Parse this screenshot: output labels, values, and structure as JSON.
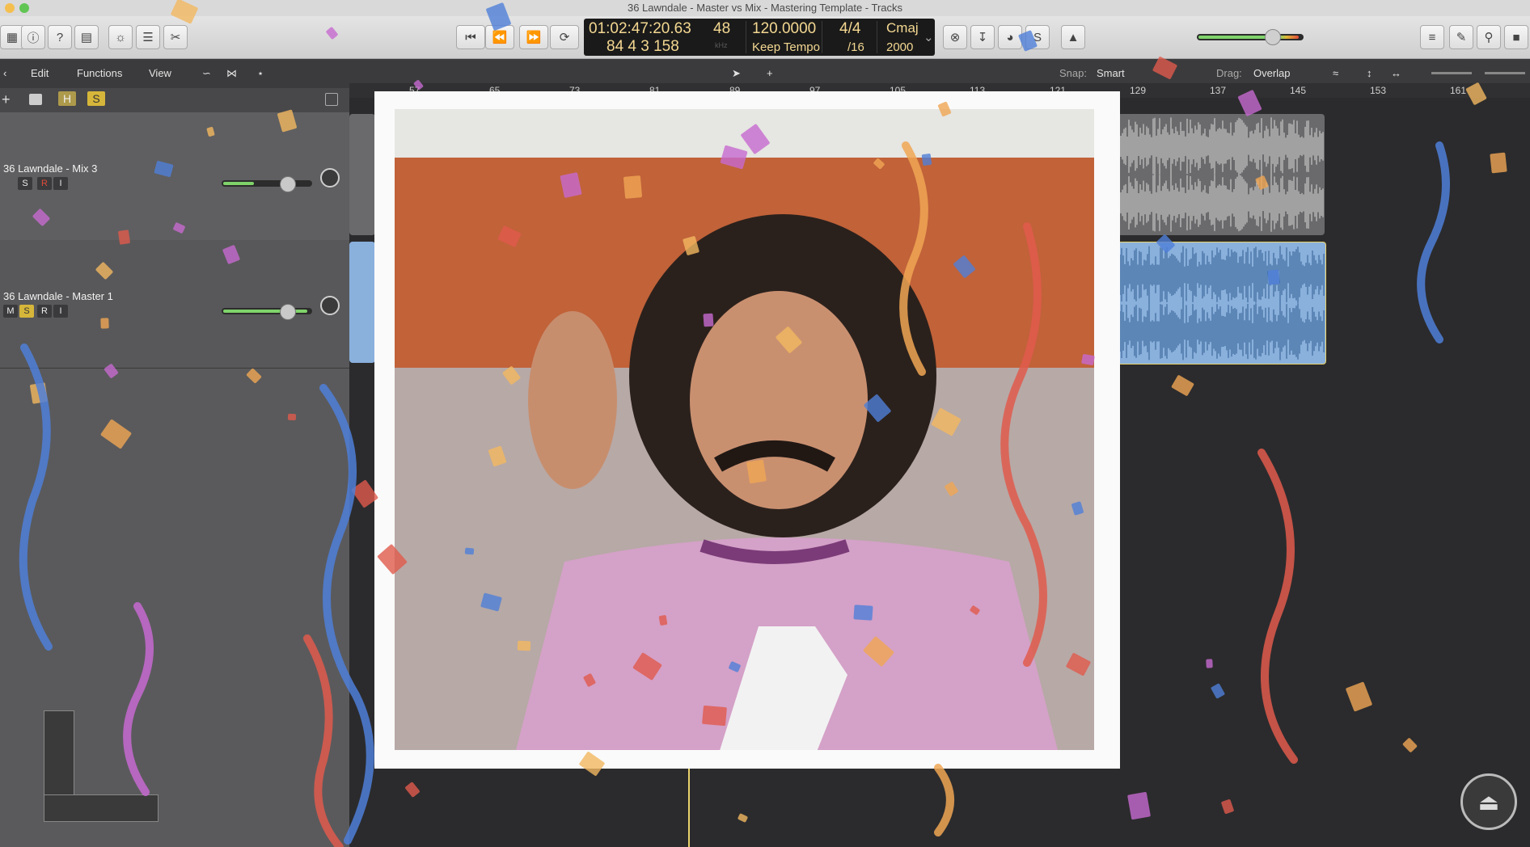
{
  "window": {
    "title": "36 Lawndale - Master vs Mix - Mastering Template - Tracks"
  },
  "lcd": {
    "time": "01:02:47:20.63",
    "bars": "84  4  3  158",
    "sample_rate": "48",
    "khz": "kHz",
    "tempo": "120.0000",
    "tempo_mode": "Keep Tempo",
    "sig_top": "4/4",
    "sig_bottom": "/16",
    "key": "Cmaj",
    "key_val": "2000"
  },
  "toolbar2": {
    "edit": "Edit",
    "functions": "Functions",
    "view": "View",
    "snap_label": "Snap:",
    "snap_value": "Smart",
    "drag_label": "Drag:",
    "drag_value": "Overlap"
  },
  "strip": {
    "h": "H",
    "s": "S"
  },
  "ruler": [
    "57",
    "65",
    "73",
    "81",
    "89",
    "97",
    "105",
    "113",
    "121",
    "129",
    "137",
    "145",
    "153",
    "161"
  ],
  "tracks": [
    {
      "name": "36 Lawndale - Mix 3",
      "s": "S",
      "r": "R",
      "i": "I",
      "volume": 0.62
    },
    {
      "name": "36 Lawndale - Master 1",
      "m": "M",
      "s": "S",
      "r": "R",
      "i": "I",
      "volume": 0.62
    }
  ],
  "colors": {
    "region_mix": "#6a6a6c",
    "region_master": "#8ab0dc",
    "playhead": "#e9d26a",
    "lcd_text": "#f4d892"
  },
  "icons": [
    "play-start-icon",
    "rewind-icon",
    "fast-forward-icon",
    "cycle-icon",
    "metronome-icon",
    "list-icon",
    "notes-icon",
    "search-icon",
    "browser-icon",
    "pointer-icon",
    "pencil-icon",
    "eject-icon"
  ]
}
